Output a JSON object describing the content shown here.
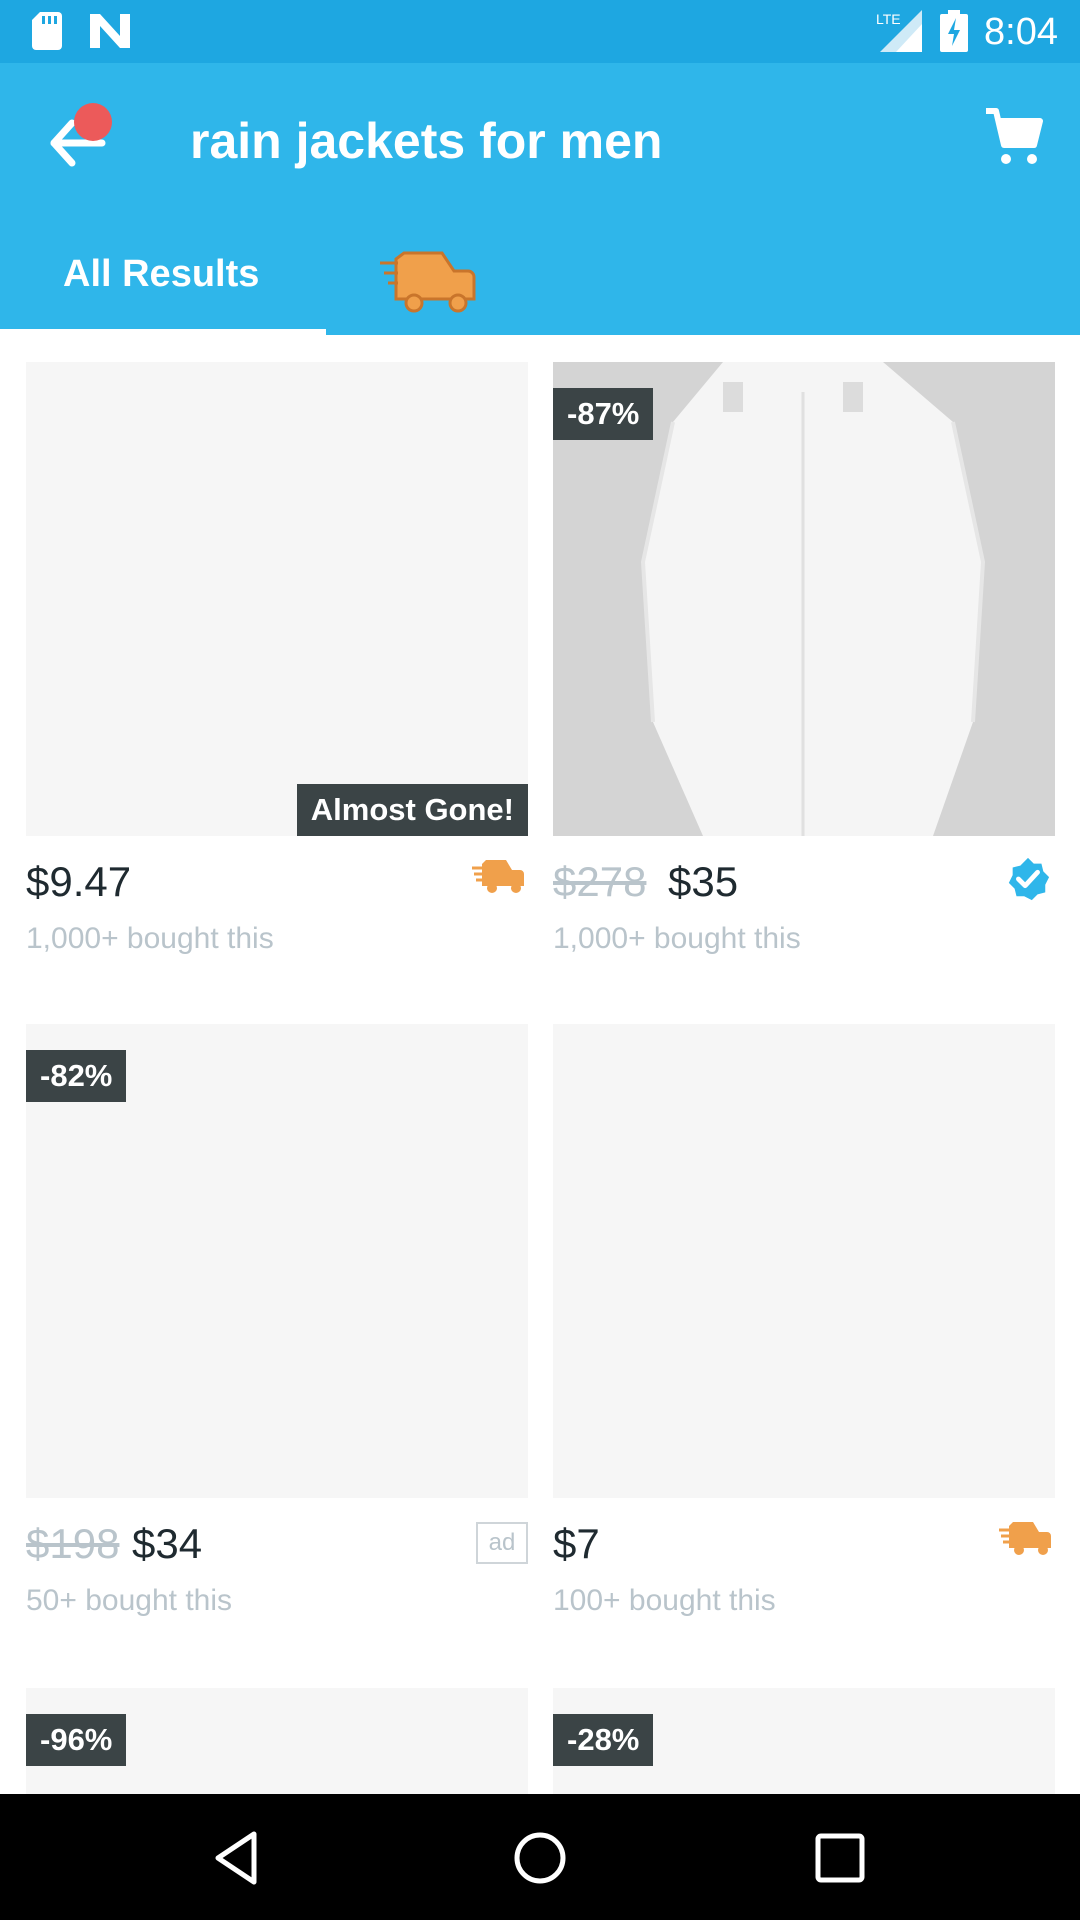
{
  "status_bar": {
    "time": "8:04",
    "network": "LTE",
    "icons": [
      "sd-card-icon",
      "n-notification-icon",
      "lte-signal-icon",
      "battery-charging-icon"
    ]
  },
  "app_bar": {
    "title": "rain jackets for men",
    "back_icon": "back-arrow-icon",
    "cart_icon": "cart-icon",
    "colors": {
      "primary": "#2fb6ea",
      "statusbar": "#1ea7e1",
      "notification_dot": "#ec5a5a"
    }
  },
  "tabs": [
    {
      "label": "All Results",
      "selected": true
    },
    {
      "label": "",
      "icon": "fast-shipping-icon",
      "selected": false
    }
  ],
  "products": [
    {
      "old_price": "",
      "price": "$9.47",
      "bought": "1,000+ bought this",
      "badge": "truck-icon",
      "tag": "Almost Gone!",
      "discount": ""
    },
    {
      "old_price": "$278",
      "price": "$35",
      "bought": "1,000+ bought this",
      "badge": "verified-check-icon",
      "tag": "",
      "discount": "-87%"
    },
    {
      "old_price": "$198",
      "price": "$34",
      "bought": "50+ bought this",
      "badge": "ad",
      "tag": "",
      "discount": "-82%"
    },
    {
      "old_price": "",
      "price": "$7",
      "bought": "100+ bought this",
      "badge": "truck-icon",
      "tag": "",
      "discount": ""
    },
    {
      "discount": "-96%"
    },
    {
      "discount": "-28%"
    }
  ],
  "nav_bar": {
    "icons": [
      "nav-back-icon",
      "nav-home-icon",
      "nav-recents-icon"
    ]
  }
}
